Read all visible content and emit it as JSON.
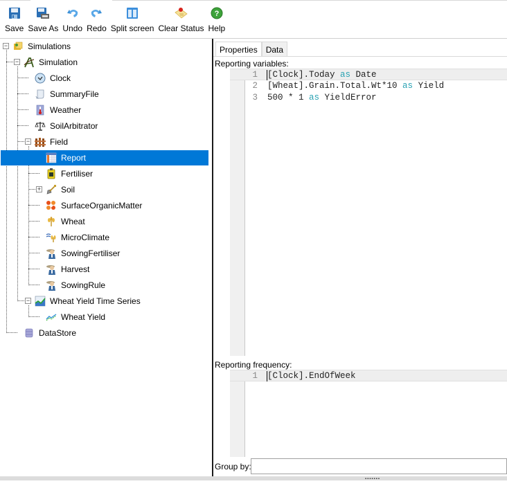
{
  "toolbar": {
    "buttons": [
      {
        "label": "Save",
        "icon": "save-icon"
      },
      {
        "label": "Save As",
        "icon": "save-as-icon"
      },
      {
        "label": "Undo",
        "icon": "undo-icon"
      },
      {
        "label": "Redo",
        "icon": "redo-icon"
      },
      {
        "label": "Split screen",
        "icon": "split-screen-icon"
      },
      {
        "label": "Clear Status",
        "icon": "clear-status-icon"
      },
      {
        "label": "Help",
        "icon": "help-icon"
      }
    ]
  },
  "tree": {
    "nodes": [
      {
        "label": "Simulations",
        "icon": "simulations-folder-icon",
        "expanded": true
      },
      {
        "label": "Simulation",
        "icon": "simulation-icon",
        "expanded": true
      },
      {
        "label": "Clock",
        "icon": "clock-icon"
      },
      {
        "label": "SummaryFile",
        "icon": "summary-file-icon"
      },
      {
        "label": "Weather",
        "icon": "weather-thermometer-icon"
      },
      {
        "label": "SoilArbitrator",
        "icon": "scales-icon"
      },
      {
        "label": "Field",
        "icon": "field-fence-icon",
        "expanded": true
      },
      {
        "label": "Report",
        "icon": "report-icon",
        "selected": true
      },
      {
        "label": "Fertiliser",
        "icon": "fertiliser-icon"
      },
      {
        "label": "Soil",
        "icon": "shovel-icon",
        "expanded": false
      },
      {
        "label": "SurfaceOrganicMatter",
        "icon": "surface-organic-matter-icon"
      },
      {
        "label": "Wheat",
        "icon": "wheat-icon"
      },
      {
        "label": "MicroClimate",
        "icon": "microclimate-icon"
      },
      {
        "label": "SowingFertiliser",
        "icon": "manager-icon"
      },
      {
        "label": "Harvest",
        "icon": "manager-icon"
      },
      {
        "label": "SowingRule",
        "icon": "manager-icon"
      },
      {
        "label": "Wheat Yield Time Series",
        "icon": "graph-icon",
        "expanded": true
      },
      {
        "label": "Wheat Yield",
        "icon": "series-icon"
      },
      {
        "label": "DataStore",
        "icon": "datastore-icon"
      }
    ]
  },
  "tabs": [
    {
      "label": "Properties",
      "active": true
    },
    {
      "label": "Data",
      "active": false
    }
  ],
  "report": {
    "variables_label": "Reporting variables:",
    "variables": [
      {
        "num": "1",
        "pre": "[Clock].Today ",
        "kw": "as",
        "post": " Date"
      },
      {
        "num": "2",
        "pre": "[Wheat].Grain.Total.Wt*10 ",
        "kw": "as",
        "post": " Yield"
      },
      {
        "num": "3",
        "pre": "500 * 1 ",
        "kw": "as",
        "post": " YieldError"
      }
    ],
    "frequency_label": "Reporting frequency:",
    "frequency": [
      {
        "num": "1",
        "code": "[Clock].EndOfWeek"
      }
    ],
    "group_by_label": "Group by:",
    "group_by_value": ""
  },
  "colors": {
    "selection": "#0078d7",
    "keyword": "#2aa2b3"
  }
}
